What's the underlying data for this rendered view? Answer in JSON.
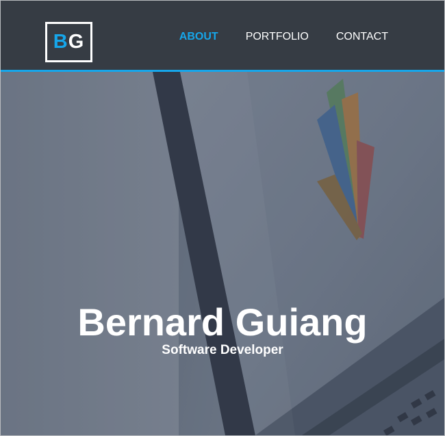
{
  "header": {
    "logo": {
      "first": "B",
      "second": "G"
    },
    "nav": [
      {
        "label": "ABOUT",
        "active": true
      },
      {
        "label": "PORTFOLIO",
        "active": false
      },
      {
        "label": "CONTACT",
        "active": false
      }
    ]
  },
  "hero": {
    "title": "Bernard Guiang",
    "subtitle": "Software Developer"
  },
  "colors": {
    "navbar_bg": "#363c44",
    "accent": "#16a6ea",
    "text": "#ffffff"
  }
}
